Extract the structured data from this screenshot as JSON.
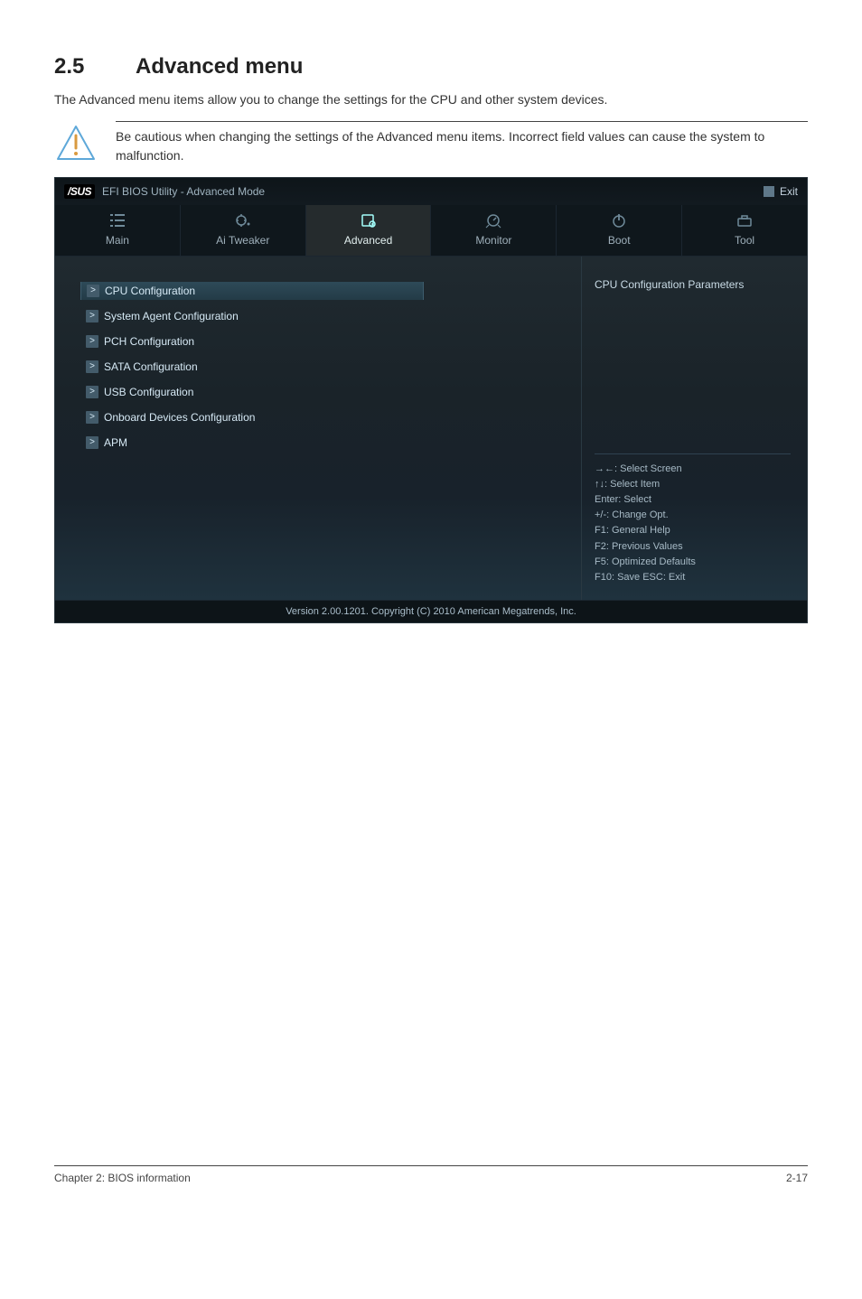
{
  "section": {
    "number": "2.5",
    "title": "Advanced menu",
    "intro": "The Advanced menu items allow you to change the settings for the CPU and other system devices.",
    "callout": "Be cautious when changing the settings of the Advanced menu items. Incorrect field values can cause the system to malfunction."
  },
  "bios": {
    "logo": "/SUS",
    "window_title": "EFI BIOS Utility - Advanced Mode",
    "exit_label": "Exit",
    "tabs": [
      {
        "label": "Main"
      },
      {
        "label": "Ai Tweaker"
      },
      {
        "label": "Advanced"
      },
      {
        "label": "Monitor"
      },
      {
        "label": "Boot"
      },
      {
        "label": "Tool"
      }
    ],
    "menu_items": [
      {
        "label": "CPU Configuration",
        "selected": true
      },
      {
        "label": "System Agent Configuration",
        "selected": false
      },
      {
        "label": "PCH Configuration",
        "selected": false
      },
      {
        "label": "SATA Configuration",
        "selected": false
      },
      {
        "label": "USB Configuration",
        "selected": false
      },
      {
        "label": "Onboard Devices Configuration",
        "selected": false
      },
      {
        "label": "APM",
        "selected": false
      }
    ],
    "side_title": "CPU Configuration Parameters",
    "help_lines": [
      "→←: Select Screen",
      "↑↓: Select Item",
      "Enter: Select",
      "+/-: Change Opt.",
      "F1: General Help",
      "F2: Previous Values",
      "F5: Optimized Defaults",
      "F10: Save   ESC: Exit"
    ],
    "footer": "Version 2.00.1201.   Copyright (C) 2010 American Megatrends, Inc."
  },
  "footer_left": "Chapter 2: BIOS information",
  "footer_right": "2-17"
}
